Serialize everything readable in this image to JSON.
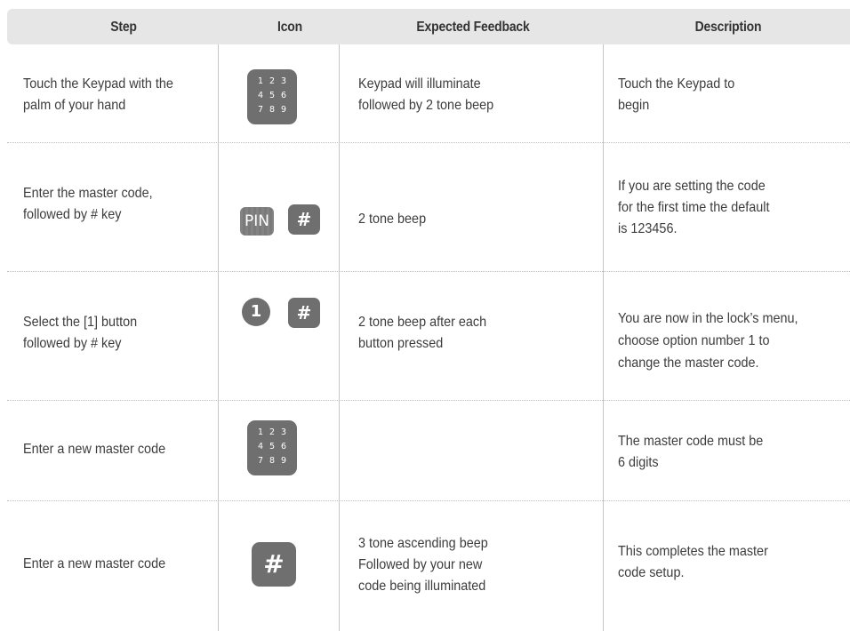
{
  "table": {
    "headers": [
      "Step",
      "Icon",
      "Expected Feedback",
      "Description"
    ],
    "rows": [
      {
        "step": [
          "Touch the Keypad with the",
          "palm of your hand"
        ],
        "icon": "keypad-icon",
        "feedback": [
          "Keypad will illuminate",
          "followed by 2 tone beep"
        ],
        "description": [
          "Touch the Keypad to",
          "begin"
        ]
      },
      {
        "step": [
          "Enter the master code,",
          "followed by # key"
        ],
        "icon": "pin-and-hash-icon",
        "feedback": [
          "2 tone beep"
        ],
        "description": [
          "If you are setting the code",
          "for the first time the default",
          "is 123456."
        ]
      },
      {
        "step": [
          "Select the [1] button",
          "followed by # key"
        ],
        "icon": "one-and-hash-icon",
        "feedback": [
          "2 tone beep after each",
          "button pressed"
        ],
        "description": [
          "You are now in the lock’s menu,",
          "choose option number 1 to",
          "change the master code."
        ]
      },
      {
        "step": [
          "Enter a new master code"
        ],
        "icon": "keypad-icon",
        "feedback": [],
        "description": [
          "The master code must be",
          "6 digits"
        ]
      },
      {
        "step": [
          "Enter a new master code"
        ],
        "icon": "hash-icon",
        "feedback": [
          "3 tone ascending beep",
          "Followed by your new",
          "code being illuminated"
        ],
        "description": [
          "This completes the master",
          "code setup."
        ]
      }
    ]
  },
  "icons": {
    "keypad_digits": [
      "1",
      "2",
      "3",
      "4",
      "5",
      "6",
      "7",
      "8",
      "9"
    ],
    "pin_label": "PIN",
    "hash_label": "#",
    "one_label": "1"
  },
  "colors": {
    "header_bg": "#e6e6e6",
    "icon_fill": "#6f6f6f",
    "text": "#3c3c3c"
  }
}
